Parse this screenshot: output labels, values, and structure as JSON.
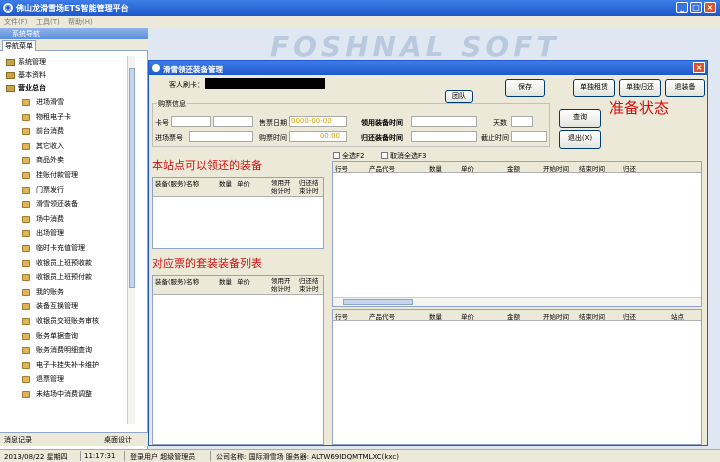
{
  "app": {
    "title": "佛山龙滑雪场ETS智能管理平台"
  },
  "menu": {
    "file": "文件(F)",
    "tools": "工具(T)",
    "help": "帮助(H)"
  },
  "nav": {
    "header": "系统导航",
    "tab": "导航菜单",
    "groups": [
      "系统管理",
      "基本资料",
      "营业总台"
    ],
    "items": [
      "进场滑雪",
      "物租电子卡",
      "前台消费",
      "其它收入",
      "商品外卖",
      "挂账付款管理",
      "门票发行",
      "滑雪领还装备",
      "场中消费",
      "出场管理",
      "临时卡充值管理",
      "收银员上班预收款",
      "收银员上班预付款",
      "我的账务",
      "装备互换管理",
      "收银员交班账务审核",
      "账务单据查询",
      "账务消费明细查询",
      "电子卡挂失补卡维护",
      "退票管理",
      "未结场中消费调整"
    ],
    "footer_left": "消息记录",
    "footer_right": "桌面设计"
  },
  "watermark": "FOSHNAL SOFT",
  "dialog": {
    "title": "滑雪领还装备管理",
    "card_label": "客人刷卡：",
    "card_value": "",
    "read_button": "团队",
    "save_button": "保存",
    "rent_button": "单独租赁",
    "return_button": "单独归还",
    "refund_button": "退装备",
    "query_button": "查询",
    "exit_button": "退出(X)",
    "purchase_group": "购票信息",
    "fields": {
      "card_no": "卡号",
      "sell_date": "售票日期",
      "sell_date_value": "0000-00-00",
      "collect_time": "领用装备时间",
      "days": "天数",
      "entry_ticket": "进场票号",
      "buy_time": "购票时间",
      "buy_time_value": "00:00",
      "return_time": "归还装备时间",
      "deadline": "截止时间"
    },
    "check_all": "全选F2",
    "uncheck_all": "取消全选F3",
    "annotation_status": "准备状态",
    "annotation_station": "本站点可以领还的装备",
    "annotation_set": "对应票的套装装备列表",
    "grid_a_cols": [
      "装备(服务)名称",
      "数量",
      "单价",
      "领用开始计时",
      "归还结束计时"
    ],
    "grid_b_cols": [
      "装备(服务)名称",
      "数量",
      "单价",
      "领用开始计时",
      "归还结束计时"
    ],
    "grid_r1_cols": [
      "行号",
      "产品代号",
      "数量",
      "单价",
      "金额",
      "开始时间",
      "结束时间",
      "归还"
    ],
    "grid_r2_cols": [
      "行号",
      "产品代号",
      "数量",
      "单价",
      "金额",
      "开始时间",
      "结束时间",
      "归还",
      "站点"
    ]
  },
  "status": {
    "date": "2013/08/22 星期四",
    "time": "11:17:31",
    "user": "登录用户 超级管理员",
    "company": "公司名称: 国际滑雪场 服务器: ALTW69IDQMTMLXC(kxc)"
  }
}
